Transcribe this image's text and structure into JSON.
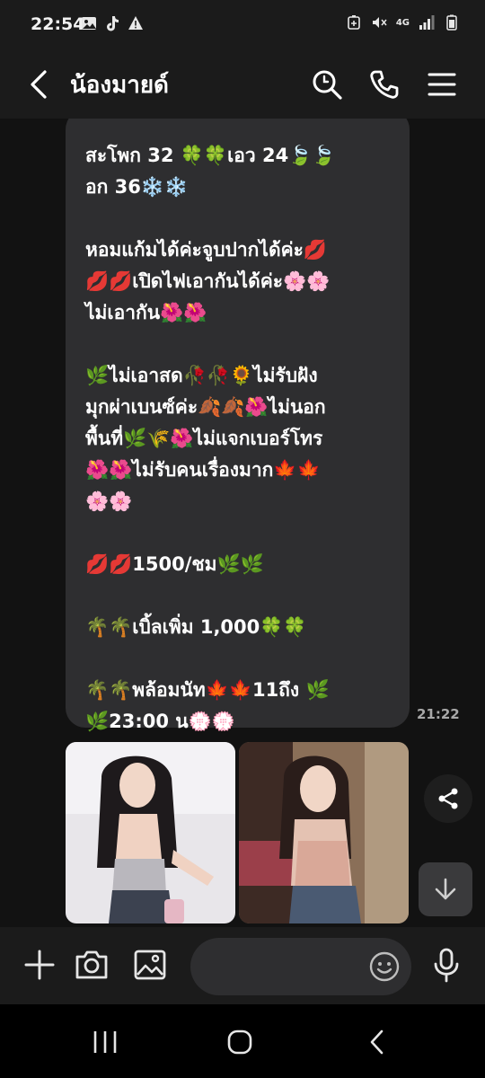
{
  "status_bar": {
    "time": "22:54",
    "network": "4G"
  },
  "header": {
    "title": "น้องมายด์"
  },
  "message": {
    "paragraphs": [
      "สะโพก 32 🍀🍀เอว 24🍃🍃\nอก 36❄️❄️",
      "หอมแก้มได้ค่ะจูบปากได้ค่ะ💋\n💋💋เปิดไฟเอากันได้ค่ะ🌸🌸\nไม่เอากัน🌺🌺",
      "🌿ไม่เอาสด🥀🥀🌻ไม่รับฝัง\nมุกผ่าเบนซ์ค่ะ🍂🍂🌺ไม่นอก\nพื้นที่🌿🌾🌺ไม่แจกเบอร์โทร\n🌺🌺ไม่รับคนเรื่องมาก🍁🍁\n🌸🌸",
      "💋💋1500/ชม🌿🌿",
      "🌴🌴เบิ้ลเพิ่ม 1,000🍀🍀",
      "🌴🌴พล้อมนัท🍁🍁11ถึง 🌿\n🌿23:00 น💮💮"
    ],
    "time": "21:22"
  },
  "colors": {
    "bubble": "#2e2e30",
    "background": "#121212",
    "bar": "#1b1b1b"
  }
}
